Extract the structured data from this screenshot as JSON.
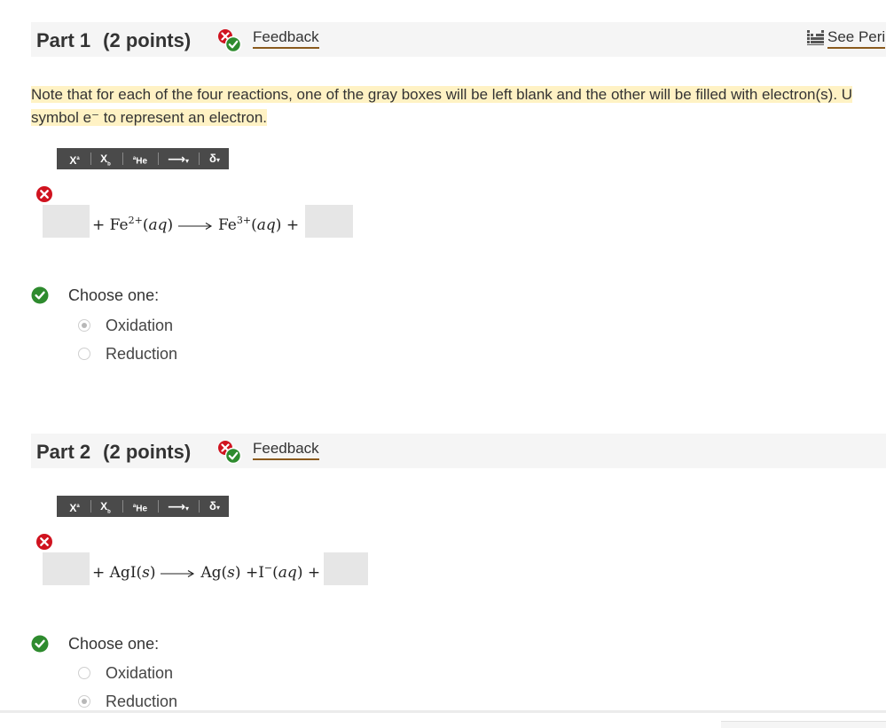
{
  "part1": {
    "title": "Part 1",
    "points": "(2 points)",
    "feedback_label": "Feedback",
    "see_periodic_label": "See Peri",
    "note_line1": "Note that for each of the four reactions, one of the gray boxes will be left blank and the other will be filled with electron(s). U",
    "note_line2": "symbol e⁻ to represent an electron.",
    "equation": {
      "left_plus": "+",
      "reactant": "Fe",
      "reactant_charge": "2+",
      "reactant_state": "aq",
      "product": "Fe",
      "product_charge": "3+",
      "product_state": "aq",
      "right_plus": "+"
    },
    "choose_label": "Choose one:",
    "options": [
      {
        "label": "Oxidation",
        "selected": true
      },
      {
        "label": "Reduction",
        "selected": false
      }
    ]
  },
  "part2": {
    "title": "Part 2",
    "points": "(2 points)",
    "feedback_label": "Feedback",
    "equation": {
      "left_plus": "+",
      "reactant": "AgI",
      "reactant_state": "s",
      "product1": "Ag",
      "product1_state": "s",
      "mid_plus": "+",
      "product2": "I",
      "product2_charge": "−",
      "product2_state": "aq",
      "right_plus": "+"
    },
    "choose_label": "Choose one:",
    "options": [
      {
        "label": "Oxidation",
        "selected": false
      },
      {
        "label": "Reduction",
        "selected": true
      }
    ]
  },
  "toolbar": {
    "superscript": "X",
    "superscript_mark": "a",
    "subscript": "X",
    "subscript_mark": "b",
    "element": "He",
    "element_mark": "a",
    "arrow": "⟶",
    "delta": "δ"
  },
  "colors": {
    "incorrect": "#d0131f",
    "correct": "#2e8b2e",
    "highlight": "#fff2c4",
    "link_underline": "#8a5a1e",
    "toolbar_bg": "#4a4a4a",
    "answer_box": "#e6e6e6"
  },
  "icons": {
    "feedback": "feedback-mixed-icon",
    "periodic_table": "periodic-table-icon",
    "incorrect": "incorrect-x-icon",
    "correct": "correct-check-icon"
  }
}
